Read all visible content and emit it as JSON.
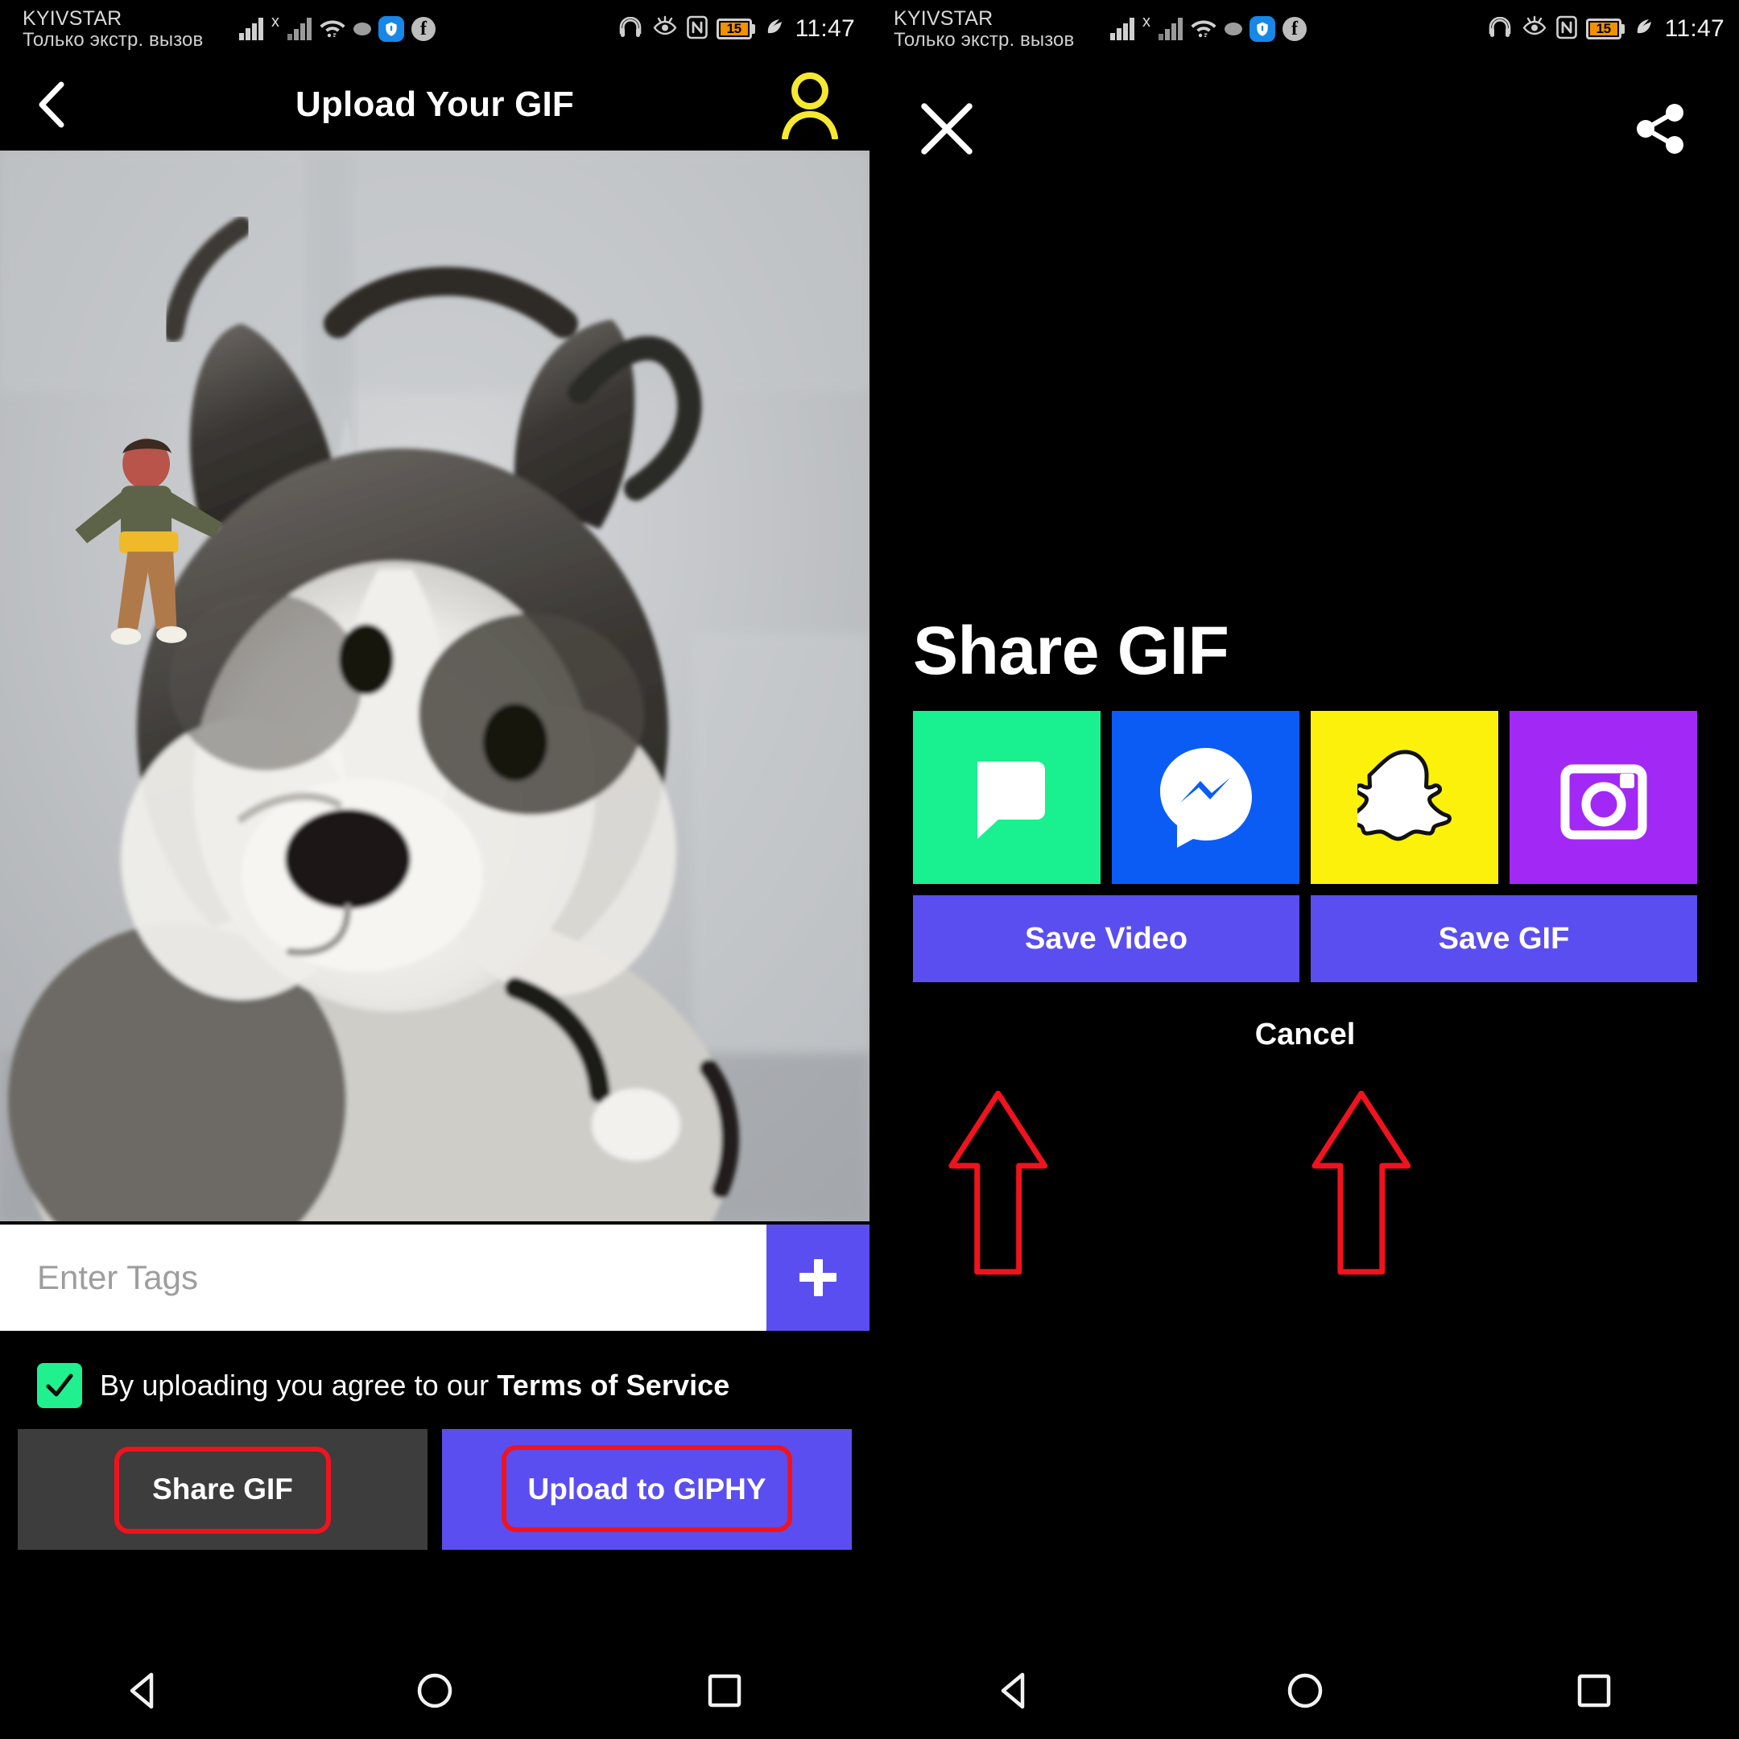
{
  "status_bar": {
    "carrier": "KYIVSTAR",
    "carrier_sub": "Только экстр. вызов",
    "sim_x": "x",
    "battery_level": "15",
    "time": "11:47",
    "icons": [
      "signal-bars-icon",
      "signal-bars-secondary-icon",
      "wifi-icon",
      "dot-icon",
      "shield-app-icon",
      "facebook-icon",
      "headphones-icon",
      "eye-comfort-icon",
      "nfc-icon",
      "battery-icon",
      "power-saving-icon"
    ]
  },
  "left_panel": {
    "appbar": {
      "back_icon": "back-chevron-icon",
      "title": "Upload Your GIF",
      "profile_icon": "profile-person-icon"
    },
    "preview": {
      "alt": "husky dog gif preview with dancing man sticker"
    },
    "tags": {
      "placeholder": "Enter Tags",
      "value": "",
      "add_label": "+"
    },
    "terms": {
      "checked": true,
      "text_plain": "By uploading you agree to our ",
      "text_bold": "Terms of Service"
    },
    "buttons": {
      "share_gif": "Share GIF",
      "upload_giphy": "Upload to GIPHY"
    }
  },
  "right_panel": {
    "close_icon": "close-x-icon",
    "share_icon": "share-node-icon",
    "sheet": {
      "title": "Share GIF",
      "tiles": [
        {
          "name": "sms",
          "label": "Messages",
          "color": "#19f08f",
          "icon": "message-bubble-icon"
        },
        {
          "name": "messenger",
          "label": "Messenger",
          "color": "#0a5cf5",
          "icon": "messenger-bolt-icon"
        },
        {
          "name": "snapchat",
          "label": "Snapchat",
          "color": "#fbf10b",
          "icon": "snapchat-ghost-icon"
        },
        {
          "name": "instagram",
          "label": "Instagram",
          "color": "#a229f5",
          "icon": "instagram-camera-icon"
        }
      ],
      "save_video": "Save Video",
      "save_gif": "Save GIF",
      "cancel": "Cancel"
    }
  },
  "nav_bar": {
    "back": "nav-back-triangle-icon",
    "home": "nav-home-circle-icon",
    "recents": "nav-recents-square-icon"
  },
  "colors": {
    "accent_purple": "#5b4ef0",
    "accent_green": "#20f08e",
    "highlight_red": "#f0131e",
    "profile_yellow": "#f5e932"
  }
}
